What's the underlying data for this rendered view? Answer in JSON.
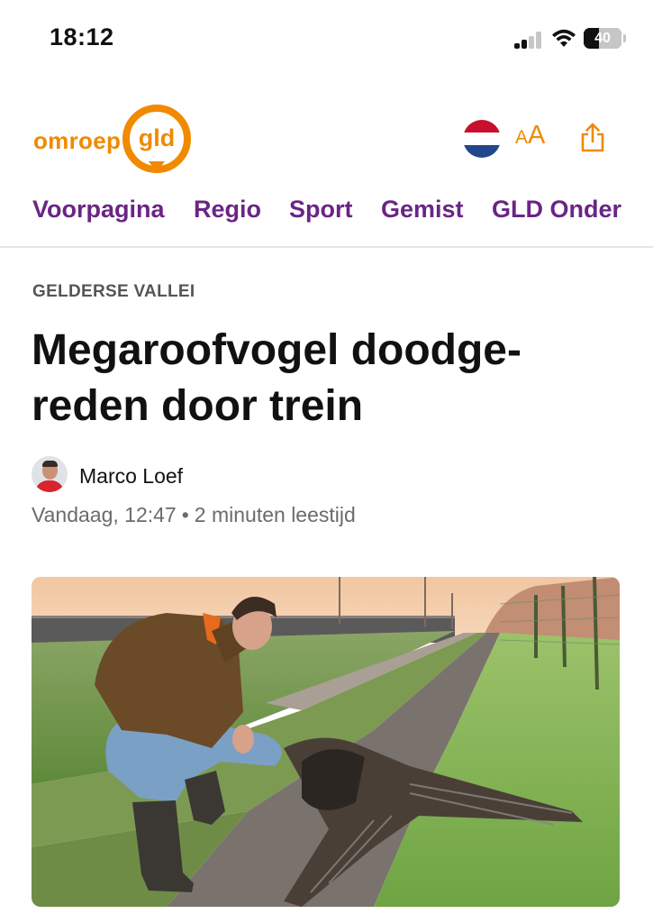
{
  "status_bar": {
    "time": "18:12",
    "battery_percent": "40",
    "battery_level": 0.4,
    "signal_bars_active": 2,
    "signal_bars_total": 4
  },
  "header": {
    "logo": {
      "word": "omroep",
      "badge": "gld",
      "color": "#f08a00"
    },
    "language_flag": {
      "icon": "dutch-flag-icon",
      "colors": [
        "#c8102e",
        "#ffffff",
        "#21468b"
      ]
    },
    "font_size_button": {
      "small": "A",
      "large": "A",
      "icon": "font-size-icon"
    },
    "share_button": {
      "icon": "share-icon"
    }
  },
  "nav": {
    "items": [
      {
        "label": "Voorpagina"
      },
      {
        "label": "Regio"
      },
      {
        "label": "Sport"
      },
      {
        "label": "Gemist"
      },
      {
        "label": "GLD Onder"
      }
    ],
    "color": "#6a2585"
  },
  "article": {
    "category": "GELDERSE VALLEI",
    "headline_line1": "Megaroofvogel doodge-",
    "headline_line2": "reden door trein",
    "author": "Marco Loef",
    "date": "Vandaag, 12:47",
    "separator": "•",
    "reading_time": "2 minuten leestijd",
    "hero_image": {
      "icon": "photo-man-with-dead-vulture"
    }
  }
}
